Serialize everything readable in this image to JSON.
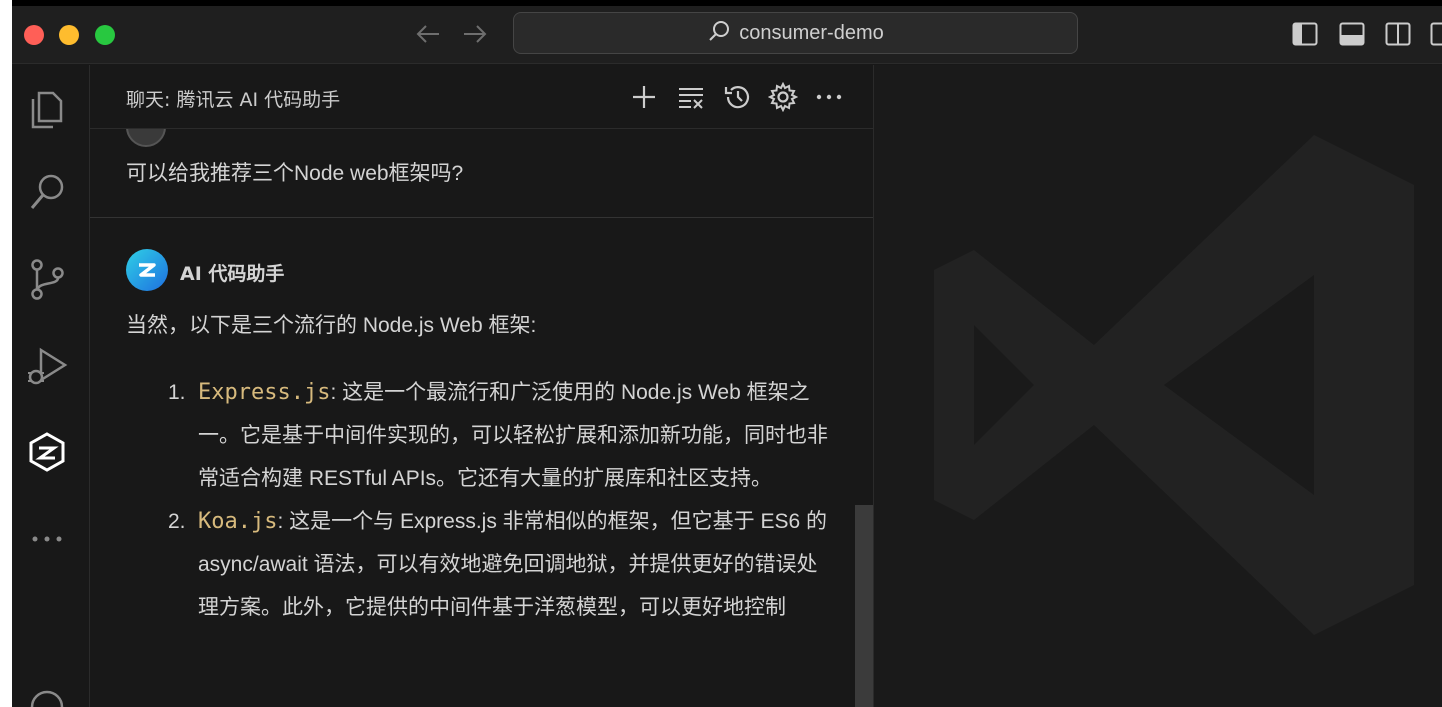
{
  "titlebar": {
    "search_text": "consumer-demo"
  },
  "chat": {
    "title": "聊天: 腾讯云 AI 代码助手",
    "user_message": "可以给我推荐三个Node web框架吗?",
    "assistant_name": "AI 代码助手",
    "assistant_intro": "当然，以下是三个流行的 Node.js Web 框架:",
    "answers": [
      {
        "num": "1.",
        "name": "Express.js",
        "text": ": 这是一个最流行和广泛使用的 Node.js Web 框架之一。它是基于中间件实现的，可以轻松扩展和添加新功能，同时也非常适合构建 RESTful APIs。它还有大量的扩展库和社区支持。"
      },
      {
        "num": "2.",
        "name": "Koa.js",
        "text": ": 这是一个与 Express.js 非常相似的框架，但它基于 ES6 的 async/await 语法，可以有效地避免回调地狱，并提供更好的错误处理方案。此外，它提供的中间件基于洋葱模型，可以更好地控制"
      }
    ]
  },
  "colors": {
    "window_bg": "#181818",
    "code_name": "#d7ba7d",
    "traffic_red": "#ff5f57",
    "traffic_yellow": "#febc2e",
    "traffic_green": "#28c840"
  }
}
